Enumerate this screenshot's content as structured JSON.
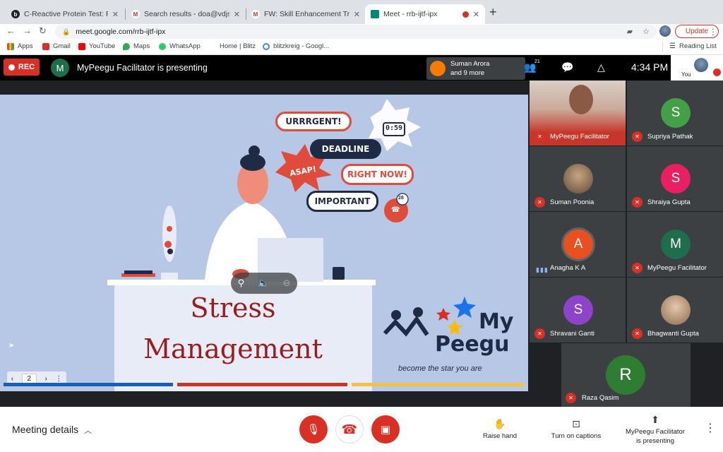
{
  "browser": {
    "tabs": [
      {
        "title": "C-Reactive Protein Test: Purpo",
        "favicon": "black-circle-icon"
      },
      {
        "title": "Search results - doa@vdjs.edu",
        "favicon": "gmail-icon"
      },
      {
        "title": "FW: Skill Enhancement Training",
        "favicon": "gmail-icon"
      },
      {
        "title": "Meet - rrb-ijtf-ipx",
        "favicon": "meet-icon"
      }
    ],
    "url": "meet.google.com/rrb-ijtf-ipx",
    "update_label": "Update",
    "bookmarks": [
      {
        "label": "Apps",
        "color": "#ea4335"
      },
      {
        "label": "Gmail",
        "color": "#d93025"
      },
      {
        "label": "YouTube",
        "color": "#ff0000"
      },
      {
        "label": "Maps",
        "color": "#34a853"
      },
      {
        "label": "WhatsApp",
        "color": "#25d366"
      },
      {
        "label": "Home | Blitz",
        "color": "#ffffff"
      },
      {
        "label": "blitzkreig - Googl...",
        "color": "#4285f4"
      }
    ],
    "reading_list": "Reading List"
  },
  "meet": {
    "rec_label": "REC",
    "presenter_initial": "M",
    "presenter_text": "MyPeegu Facilitator is presenting",
    "joiner_name": "Suman Arora",
    "joiner_more": "and 9 more",
    "people_count": "21",
    "time": "4:34 PM",
    "you_label": "You",
    "slide": {
      "title_line1": "Stress",
      "title_line2": "Management",
      "bubbles": [
        "URRRGENT!",
        "DEADLINE",
        "ASAP!",
        "RIGHT NOW!",
        "IMPORTANT"
      ],
      "clock_text": "0:59",
      "phone_count": "28",
      "logo_my": "My",
      "logo_peegu": "Peegu",
      "logo_tagline": "become the star you are",
      "page_number": "2"
    },
    "participants": [
      {
        "name": "MyPeegu Facilitator",
        "initial": "",
        "color": "#b34a3a",
        "video": true
      },
      {
        "name": "Supriya Pathak",
        "initial": "S",
        "color": "#43a047"
      },
      {
        "name": "Suman Poonia",
        "initial": "",
        "color": "#7a6a55"
      },
      {
        "name": "Shraiya Gupta",
        "initial": "S",
        "color": "#e91e63"
      },
      {
        "name": "Anagha K A",
        "initial": "A",
        "color": "#e8501f"
      },
      {
        "name": "MyPeegu Facilitator",
        "initial": "M",
        "color": "#1e6e4e"
      },
      {
        "name": "Shravani Ganti",
        "initial": "S",
        "color": "#8e44c9"
      },
      {
        "name": "Bhagwanti Gupta",
        "initial": "",
        "color": "#9a7b5e"
      },
      {
        "name": "Raza Qasim",
        "initial": "R",
        "color": "#2e7d32"
      }
    ]
  },
  "bottom": {
    "meeting_details": "Meeting details",
    "raise_hand": "Raise hand",
    "captions": "Turn on captions",
    "presenting_line1": "MyPeegu Facilitator",
    "presenting_line2": "is presenting"
  }
}
